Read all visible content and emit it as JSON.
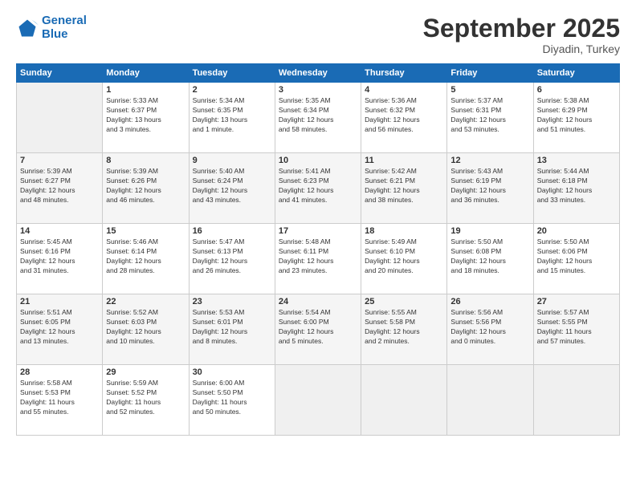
{
  "logo": {
    "line1": "General",
    "line2": "Blue"
  },
  "title": "September 2025",
  "subtitle": "Diyadin, Turkey",
  "days_header": [
    "Sunday",
    "Monday",
    "Tuesday",
    "Wednesday",
    "Thursday",
    "Friday",
    "Saturday"
  ],
  "weeks": [
    [
      {
        "num": "",
        "info": ""
      },
      {
        "num": "1",
        "info": "Sunrise: 5:33 AM\nSunset: 6:37 PM\nDaylight: 13 hours\nand 3 minutes."
      },
      {
        "num": "2",
        "info": "Sunrise: 5:34 AM\nSunset: 6:35 PM\nDaylight: 13 hours\nand 1 minute."
      },
      {
        "num": "3",
        "info": "Sunrise: 5:35 AM\nSunset: 6:34 PM\nDaylight: 12 hours\nand 58 minutes."
      },
      {
        "num": "4",
        "info": "Sunrise: 5:36 AM\nSunset: 6:32 PM\nDaylight: 12 hours\nand 56 minutes."
      },
      {
        "num": "5",
        "info": "Sunrise: 5:37 AM\nSunset: 6:31 PM\nDaylight: 12 hours\nand 53 minutes."
      },
      {
        "num": "6",
        "info": "Sunrise: 5:38 AM\nSunset: 6:29 PM\nDaylight: 12 hours\nand 51 minutes."
      }
    ],
    [
      {
        "num": "7",
        "info": "Sunrise: 5:39 AM\nSunset: 6:27 PM\nDaylight: 12 hours\nand 48 minutes."
      },
      {
        "num": "8",
        "info": "Sunrise: 5:39 AM\nSunset: 6:26 PM\nDaylight: 12 hours\nand 46 minutes."
      },
      {
        "num": "9",
        "info": "Sunrise: 5:40 AM\nSunset: 6:24 PM\nDaylight: 12 hours\nand 43 minutes."
      },
      {
        "num": "10",
        "info": "Sunrise: 5:41 AM\nSunset: 6:23 PM\nDaylight: 12 hours\nand 41 minutes."
      },
      {
        "num": "11",
        "info": "Sunrise: 5:42 AM\nSunset: 6:21 PM\nDaylight: 12 hours\nand 38 minutes."
      },
      {
        "num": "12",
        "info": "Sunrise: 5:43 AM\nSunset: 6:19 PM\nDaylight: 12 hours\nand 36 minutes."
      },
      {
        "num": "13",
        "info": "Sunrise: 5:44 AM\nSunset: 6:18 PM\nDaylight: 12 hours\nand 33 minutes."
      }
    ],
    [
      {
        "num": "14",
        "info": "Sunrise: 5:45 AM\nSunset: 6:16 PM\nDaylight: 12 hours\nand 31 minutes."
      },
      {
        "num": "15",
        "info": "Sunrise: 5:46 AM\nSunset: 6:14 PM\nDaylight: 12 hours\nand 28 minutes."
      },
      {
        "num": "16",
        "info": "Sunrise: 5:47 AM\nSunset: 6:13 PM\nDaylight: 12 hours\nand 26 minutes."
      },
      {
        "num": "17",
        "info": "Sunrise: 5:48 AM\nSunset: 6:11 PM\nDaylight: 12 hours\nand 23 minutes."
      },
      {
        "num": "18",
        "info": "Sunrise: 5:49 AM\nSunset: 6:10 PM\nDaylight: 12 hours\nand 20 minutes."
      },
      {
        "num": "19",
        "info": "Sunrise: 5:50 AM\nSunset: 6:08 PM\nDaylight: 12 hours\nand 18 minutes."
      },
      {
        "num": "20",
        "info": "Sunrise: 5:50 AM\nSunset: 6:06 PM\nDaylight: 12 hours\nand 15 minutes."
      }
    ],
    [
      {
        "num": "21",
        "info": "Sunrise: 5:51 AM\nSunset: 6:05 PM\nDaylight: 12 hours\nand 13 minutes."
      },
      {
        "num": "22",
        "info": "Sunrise: 5:52 AM\nSunset: 6:03 PM\nDaylight: 12 hours\nand 10 minutes."
      },
      {
        "num": "23",
        "info": "Sunrise: 5:53 AM\nSunset: 6:01 PM\nDaylight: 12 hours\nand 8 minutes."
      },
      {
        "num": "24",
        "info": "Sunrise: 5:54 AM\nSunset: 6:00 PM\nDaylight: 12 hours\nand 5 minutes."
      },
      {
        "num": "25",
        "info": "Sunrise: 5:55 AM\nSunset: 5:58 PM\nDaylight: 12 hours\nand 2 minutes."
      },
      {
        "num": "26",
        "info": "Sunrise: 5:56 AM\nSunset: 5:56 PM\nDaylight: 12 hours\nand 0 minutes."
      },
      {
        "num": "27",
        "info": "Sunrise: 5:57 AM\nSunset: 5:55 PM\nDaylight: 11 hours\nand 57 minutes."
      }
    ],
    [
      {
        "num": "28",
        "info": "Sunrise: 5:58 AM\nSunset: 5:53 PM\nDaylight: 11 hours\nand 55 minutes."
      },
      {
        "num": "29",
        "info": "Sunrise: 5:59 AM\nSunset: 5:52 PM\nDaylight: 11 hours\nand 52 minutes."
      },
      {
        "num": "30",
        "info": "Sunrise: 6:00 AM\nSunset: 5:50 PM\nDaylight: 11 hours\nand 50 minutes."
      },
      {
        "num": "",
        "info": ""
      },
      {
        "num": "",
        "info": ""
      },
      {
        "num": "",
        "info": ""
      },
      {
        "num": "",
        "info": ""
      }
    ]
  ]
}
